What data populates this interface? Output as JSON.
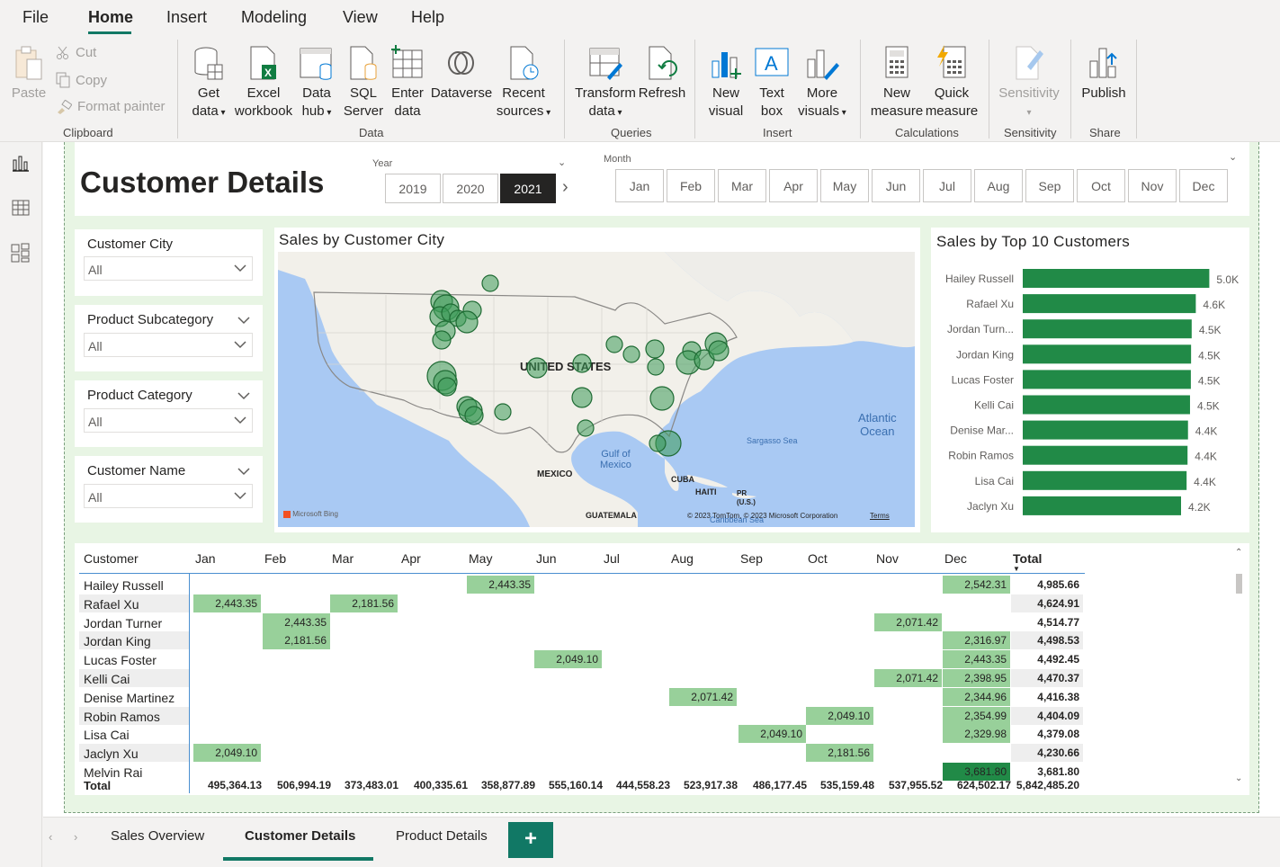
{
  "menu": {
    "items": [
      "File",
      "Home",
      "Insert",
      "Modeling",
      "View",
      "Help"
    ],
    "active": "Home"
  },
  "ribbon": {
    "clipboard": {
      "paste": "Paste",
      "cut": "Cut",
      "copy": "Copy",
      "format_painter": "Format painter",
      "group": "Clipboard"
    },
    "data": {
      "get_data": [
        "Get",
        "data"
      ],
      "excel": [
        "Excel",
        "workbook"
      ],
      "data_hub": [
        "Data",
        "hub"
      ],
      "sql": [
        "SQL",
        "Server"
      ],
      "enter": [
        "Enter",
        "data"
      ],
      "dataverse": "Dataverse",
      "recent": [
        "Recent",
        "sources"
      ],
      "group": "Data"
    },
    "queries": {
      "transform": [
        "Transform",
        "data"
      ],
      "refresh": "Refresh",
      "group": "Queries"
    },
    "insert": {
      "new_visual": [
        "New",
        "visual"
      ],
      "text_box": [
        "Text",
        "box"
      ],
      "more_visuals": [
        "More",
        "visuals"
      ],
      "group": "Insert"
    },
    "calculations": {
      "new_measure": [
        "New",
        "measure"
      ],
      "quick_measure": [
        "Quick",
        "measure"
      ],
      "group": "Calculations"
    },
    "sensitivity": {
      "label": "Sensitivity",
      "group": "Sensitivity"
    },
    "share": {
      "publish": "Publish",
      "group": "Share"
    }
  },
  "report": {
    "title": "Customer Details",
    "year_slicer": {
      "label": "Year",
      "options": [
        "2019",
        "2020",
        "2021"
      ],
      "selected": "2021"
    },
    "month_slicer": {
      "label": "Month",
      "options": [
        "Jan",
        "Feb",
        "Mar",
        "Apr",
        "May",
        "Jun",
        "Jul",
        "Aug",
        "Sep",
        "Oct",
        "Nov",
        "Dec"
      ]
    },
    "filters": [
      {
        "title": "Customer City",
        "value": "All"
      },
      {
        "title": "Product Subcategory",
        "value": "All"
      },
      {
        "title": "Product Category",
        "value": "All"
      },
      {
        "title": "Customer Name",
        "value": "All"
      }
    ],
    "map": {
      "title": "Sales by Customer City",
      "labels": {
        "us": "UNITED STATES",
        "mexico": "MEXICO",
        "gulf": [
          "Gulf of",
          "Mexico"
        ],
        "atlantic": [
          "Atlantic",
          "Ocean"
        ],
        "sargasso": "Sargasso Sea",
        "cuba": "CUBA",
        "haiti": "HAITI",
        "pr": [
          "PR",
          "(U.S.)"
        ],
        "guatemala": "GUATEMALA",
        "caribbean": "Caribbean Sea",
        "bing": "Microsoft Bing",
        "copyright": "© 2023 TomTom, © 2023 Microsoft Corporation",
        "terms": "Terms"
      }
    },
    "bar_title": "Sales by Top 10 Customers",
    "matrix": {
      "headers": [
        "Customer",
        "Jan",
        "Feb",
        "Mar",
        "Apr",
        "May",
        "Jun",
        "Jul",
        "Aug",
        "Sep",
        "Oct",
        "Nov",
        "Dec",
        "Total"
      ],
      "rows": [
        {
          "name": "Hailey Russell",
          "cells": {
            "May": "2,443.35",
            "Dec": "2,542.31"
          },
          "total": "4,985.66"
        },
        {
          "name": "Rafael Xu",
          "cells": {
            "Jan": "2,443.35",
            "Mar": "2,181.56"
          },
          "total": "4,624.91"
        },
        {
          "name": "Jordan Turner",
          "cells": {
            "Feb": "2,443.35",
            "Nov": "2,071.42"
          },
          "total": "4,514.77"
        },
        {
          "name": "Jordan King",
          "cells": {
            "Feb": "2,181.56",
            "Dec": "2,316.97"
          },
          "total": "4,498.53"
        },
        {
          "name": "Lucas Foster",
          "cells": {
            "Jun": "2,049.10",
            "Dec": "2,443.35"
          },
          "total": "4,492.45"
        },
        {
          "name": "Kelli Cai",
          "cells": {
            "Nov": "2,071.42",
            "Dec": "2,398.95"
          },
          "total": "4,470.37"
        },
        {
          "name": "Denise Martinez",
          "cells": {
            "Aug": "2,071.42",
            "Dec": "2,344.96"
          },
          "total": "4,416.38"
        },
        {
          "name": "Robin Ramos",
          "cells": {
            "Oct": "2,049.10",
            "Dec": "2,354.99"
          },
          "total": "4,404.09"
        },
        {
          "name": "Lisa Cai",
          "cells": {
            "Sep": "2,049.10",
            "Dec": "2,329.98"
          },
          "total": "4,379.08"
        },
        {
          "name": "Jaclyn Xu",
          "cells": {
            "Jan": "2,049.10",
            "Oct": "2,181.56"
          },
          "total": "4,230.66"
        },
        {
          "name": "Melvin Rai",
          "cells": {
            "Dec": "3,681.80"
          },
          "total": "3,681.80"
        }
      ],
      "total_row": {
        "label": "Total",
        "values": [
          "495,364.13",
          "506,994.19",
          "373,483.01",
          "400,335.61",
          "358,877.89",
          "555,160.14",
          "444,558.23",
          "523,917.38",
          "486,177.45",
          "535,159.48",
          "537,955.52",
          "624,502.17",
          "5,842,485.20"
        ]
      }
    }
  },
  "chart_data": {
    "type": "bar",
    "title": "Sales by Top 10 Customers",
    "orientation": "horizontal",
    "categories": [
      "Hailey Russell",
      "Rafael Xu",
      "Jordan Turn...",
      "Jordan King",
      "Lucas Foster",
      "Kelli Cai",
      "Denise Mar...",
      "Robin Ramos",
      "Lisa Cai",
      "Jaclyn Xu"
    ],
    "values": [
      4985.66,
      4624.91,
      4514.77,
      4498.53,
      4492.45,
      4470.37,
      4416.38,
      4404.09,
      4379.08,
      4230.66
    ],
    "data_labels": [
      "5.0K",
      "4.6K",
      "4.5K",
      "4.5K",
      "4.5K",
      "4.5K",
      "4.4K",
      "4.4K",
      "4.4K",
      "4.2K"
    ],
    "bar_color": "#218a47",
    "grid": false
  },
  "tabs": {
    "items": [
      "Sales Overview",
      "Customer Details",
      "Product Details"
    ],
    "active": "Customer Details",
    "add_label": "+"
  },
  "colors": {
    "accent": "#117865",
    "bar_green": "#218a47",
    "canvas_green": "#e8f5e4"
  }
}
